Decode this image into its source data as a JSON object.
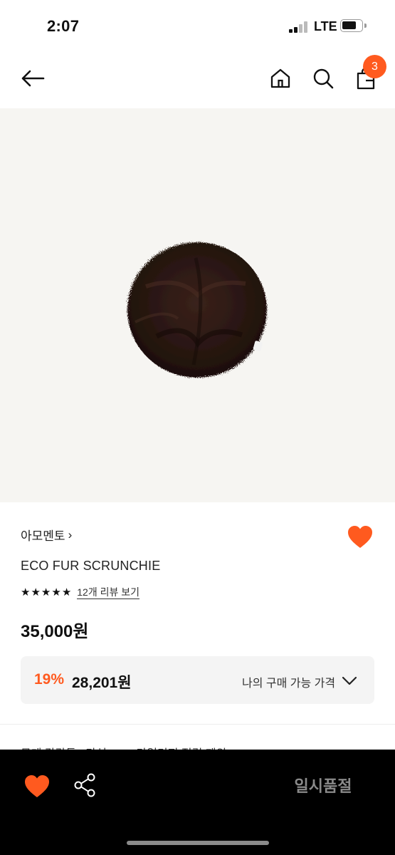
{
  "status": {
    "time": "2:07",
    "network": "LTE",
    "icons": [
      "signal-icon",
      "battery-icon"
    ]
  },
  "nav": {
    "back_icon": "arrow-left-icon",
    "home_icon": "home-icon",
    "search_icon": "search-icon",
    "cart_icon": "shopping-bag-icon",
    "cart_count": "3"
  },
  "product": {
    "image_alt": "brown eco fur scrunchie",
    "brand": "아모멘토",
    "brand_chevron": "›",
    "name": "ECO FUR SCRUNCHIE",
    "rating_stars": 5,
    "review_link": "12개 리뷰 보기",
    "price": "35,000원",
    "wish_icon": "heart-icon"
  },
  "my_price": {
    "discount": "19%",
    "price": "28,201원",
    "label": "나의 구매 가능 가격",
    "chevron_icon": "chevron-down-icon"
  },
  "peek": {
    "text": "무게 감각들 : 다섯 SNS 마일리지 적립 제외"
  },
  "bottom_bar": {
    "wish_icon": "heart-icon",
    "share_icon": "share-icon",
    "soldout_label": "일시품절"
  },
  "colors": {
    "accent": "#ff5a1f",
    "image_bg": "#f6f5f2",
    "fur": "#2a1712",
    "bottom_bar": "#000000"
  }
}
